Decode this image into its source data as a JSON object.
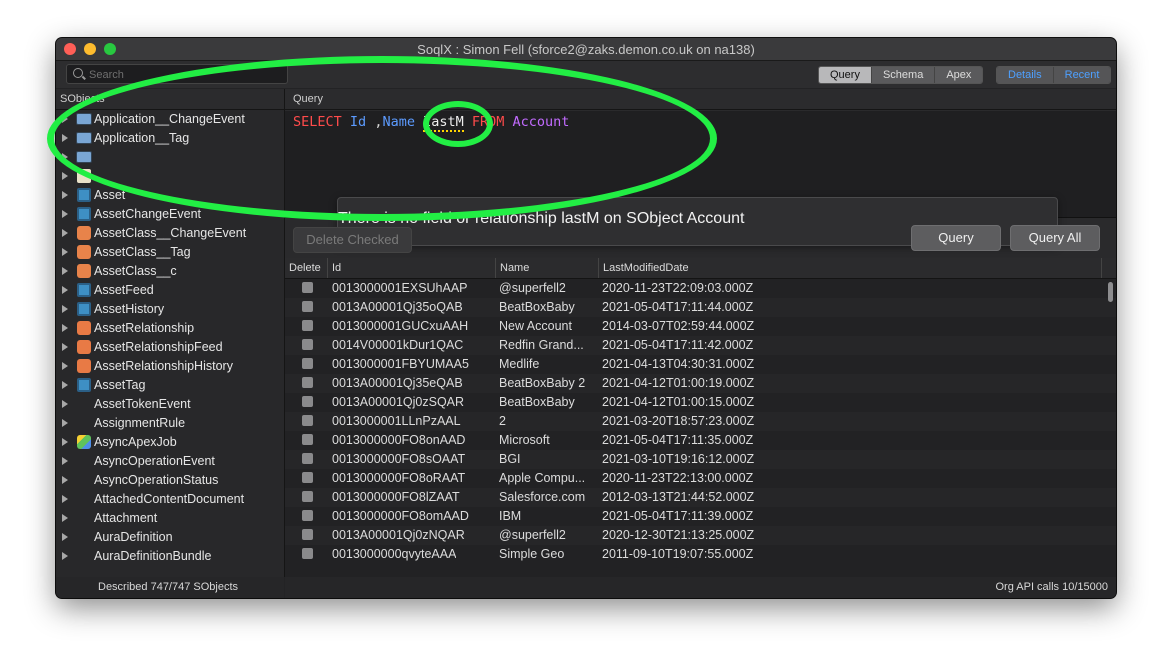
{
  "window": {
    "title": "SoqlX : Simon Fell (sforce2@zaks.demon.co.uk on na138)"
  },
  "search": {
    "placeholder": "Search"
  },
  "tabs": [
    "Query",
    "Schema",
    "Apex"
  ],
  "links": [
    "Details",
    "Recent"
  ],
  "sidebar": {
    "header": "SObjects",
    "items": [
      {
        "label": "Application__ChangeEvent",
        "icon": "monitor-icon"
      },
      {
        "label": "Application__Tag",
        "icon": "monitor-icon"
      },
      {
        "label": "",
        "icon": "monitor-icon"
      },
      {
        "label": "",
        "icon": "document-icon"
      },
      {
        "label": "Asset",
        "icon": "square-icon"
      },
      {
        "label": "AssetChangeEvent",
        "icon": "square-icon"
      },
      {
        "label": "AssetClass__ChangeEvent",
        "icon": "blocks-icon"
      },
      {
        "label": "AssetClass__Tag",
        "icon": "blocks-icon"
      },
      {
        "label": "AssetClass__c",
        "icon": "blocks-icon"
      },
      {
        "label": "AssetFeed",
        "icon": "square-icon"
      },
      {
        "label": "AssetHistory",
        "icon": "square-icon"
      },
      {
        "label": "AssetRelationship",
        "icon": "people-icon"
      },
      {
        "label": "AssetRelationshipFeed",
        "icon": "people-icon"
      },
      {
        "label": "AssetRelationshipHistory",
        "icon": "people-icon"
      },
      {
        "label": "AssetTag",
        "icon": "square-icon"
      },
      {
        "label": "AssetTokenEvent",
        "icon": ""
      },
      {
        "label": "AssignmentRule",
        "icon": ""
      },
      {
        "label": "AsyncApexJob",
        "icon": "cube-icon"
      },
      {
        "label": "AsyncOperationEvent",
        "icon": ""
      },
      {
        "label": "AsyncOperationStatus",
        "icon": ""
      },
      {
        "label": "AttachedContentDocument",
        "icon": ""
      },
      {
        "label": "Attachment",
        "icon": ""
      },
      {
        "label": "AuraDefinition",
        "icon": ""
      },
      {
        "label": "AuraDefinitionBundle",
        "icon": ""
      }
    ],
    "status": "Described 747/747 SObjects"
  },
  "query": {
    "header": "Query",
    "tokens": {
      "select": "SELECT",
      "id": "Id",
      "sep1": " ,",
      "name": "Name",
      "sep2": " ",
      "err": "lastM",
      "from": " FROM ",
      "obj": "Account"
    },
    "error": "There is no field or relationship lastM on SObject Account"
  },
  "buttons": {
    "delete": "Delete Checked",
    "query": "Query",
    "query_all": "Query All"
  },
  "grid": {
    "headers": [
      "Delete",
      "Id",
      "Name",
      "LastModifiedDate"
    ],
    "rows": [
      [
        "0013000001EXSUhAAP",
        "@superfell2",
        "2020-11-23T22:09:03.000Z"
      ],
      [
        "0013A00001Qj35oQAB",
        "BeatBoxBaby",
        "2021-05-04T17:11:44.000Z"
      ],
      [
        "0013000001GUCxuAAH",
        "New Account",
        "2014-03-07T02:59:44.000Z"
      ],
      [
        "0014V00001kDur1QAC",
        "Redfin Grand...",
        "2021-05-04T17:11:42.000Z"
      ],
      [
        "0013000001FBYUMAA5",
        "Medlife",
        "2021-04-13T04:30:31.000Z"
      ],
      [
        "0013A00001Qj35eQAB",
        "BeatBoxBaby 2",
        "2021-04-12T01:00:19.000Z"
      ],
      [
        "0013A00001Qj0zSQAR",
        "BeatBoxBaby",
        "2021-04-12T01:00:15.000Z"
      ],
      [
        "0013000001LLnPzAAL",
        "2",
        "2021-03-20T18:57:23.000Z"
      ],
      [
        "0013000000FO8onAAD",
        "Microsoft",
        "2021-05-04T17:11:35.000Z"
      ],
      [
        "0013000000FO8sOAAT",
        "BGI",
        "2021-03-10T19:16:12.000Z"
      ],
      [
        "0013000000FO8oRAAT",
        "Apple Compu...",
        "2020-11-23T22:13:00.000Z"
      ],
      [
        "0013000000FO8lZAAT",
        "Salesforce.com",
        "2012-03-13T21:44:52.000Z"
      ],
      [
        "0013000000FO8omAAD",
        "IBM",
        "2021-05-04T17:11:39.000Z"
      ],
      [
        "0013A00001Qj0zNQAR",
        "@superfell2",
        "2020-12-30T21:13:25.000Z"
      ],
      [
        "0013000000qvyteAAA",
        "Simple Geo",
        "2011-09-10T19:07:55.000Z"
      ]
    ]
  },
  "status_right": "Org API calls 10/15000",
  "colors": {
    "keyword": "#ff4b4b",
    "field": "#5c9bff",
    "object": "#c26bff",
    "error_underline": "#ffd400",
    "annotation": "#22ee44"
  }
}
